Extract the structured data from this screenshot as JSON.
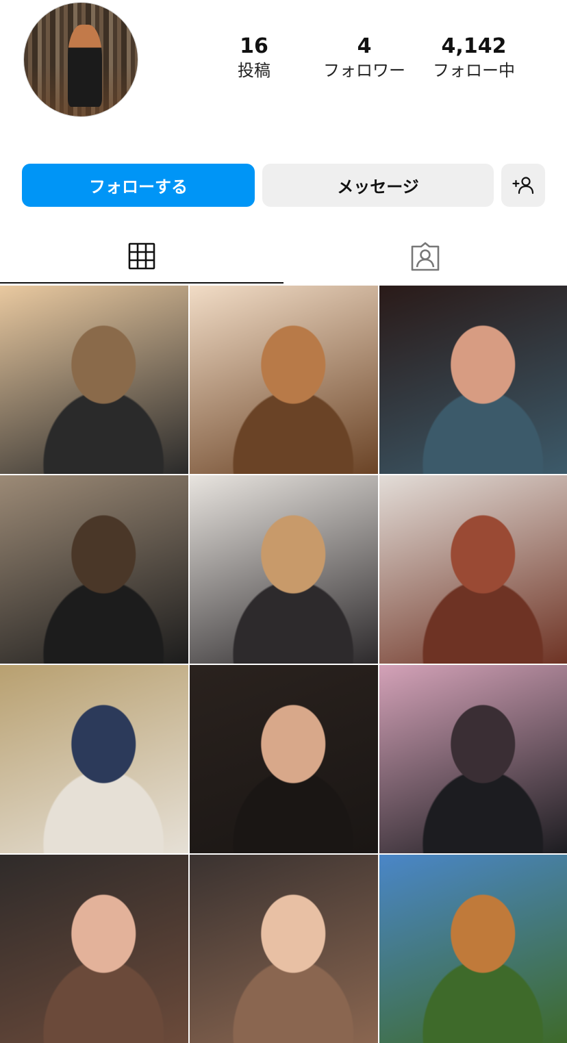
{
  "profile": {
    "stats": [
      {
        "value": "16",
        "label": "投稿"
      },
      {
        "value": "4",
        "label": "フォロワー"
      },
      {
        "value": "4,142",
        "label": "フォロー中"
      }
    ]
  },
  "actions": {
    "follow_label": "フォローする",
    "message_label": "メッセージ",
    "add_user_icon": "add-user-icon"
  },
  "tabs": [
    {
      "icon": "grid-icon",
      "active": true
    },
    {
      "icon": "tagged-user-icon",
      "active": false
    }
  ],
  "colors": {
    "accent": "#0095f6",
    "button_gray": "#efefef",
    "text": "#111111"
  },
  "posts": [
    {
      "name": "post-photo-1",
      "tones": [
        "#e9c9a0",
        "#8a6a4a",
        "#2a2a2a"
      ]
    },
    {
      "name": "post-photo-2",
      "tones": [
        "#f1dcc6",
        "#b87a48",
        "#6a4326"
      ]
    },
    {
      "name": "post-photo-3",
      "tones": [
        "#2a1a18",
        "#d79c82",
        "#3c5a6a"
      ]
    },
    {
      "name": "post-photo-4",
      "tones": [
        "#9c8a76",
        "#4a3728",
        "#1c1c1c"
      ]
    },
    {
      "name": "post-photo-5",
      "tones": [
        "#e8e4df",
        "#c89a6a",
        "#2d2a2c"
      ]
    },
    {
      "name": "post-photo-6",
      "tones": [
        "#e3ddd8",
        "#9a4a34",
        "#6e3324"
      ]
    },
    {
      "name": "post-photo-7",
      "tones": [
        "#b8a070",
        "#2c3a5a",
        "#e6e0d6"
      ]
    },
    {
      "name": "post-photo-8",
      "tones": [
        "#2a221e",
        "#d8a88a",
        "#1a1614"
      ]
    },
    {
      "name": "post-photo-9",
      "tones": [
        "#d4a2b8",
        "#3a2e34",
        "#1c1c20"
      ]
    },
    {
      "name": "post-photo-10",
      "tones": [
        "#2f2b2a",
        "#e3b29a",
        "#6b4a3a"
      ]
    },
    {
      "name": "post-photo-11",
      "tones": [
        "#3a3230",
        "#e8c0a4",
        "#8a6650"
      ]
    },
    {
      "name": "post-photo-12",
      "tones": [
        "#4a86c8",
        "#c07a3a",
        "#3e6a2a"
      ]
    }
  ]
}
